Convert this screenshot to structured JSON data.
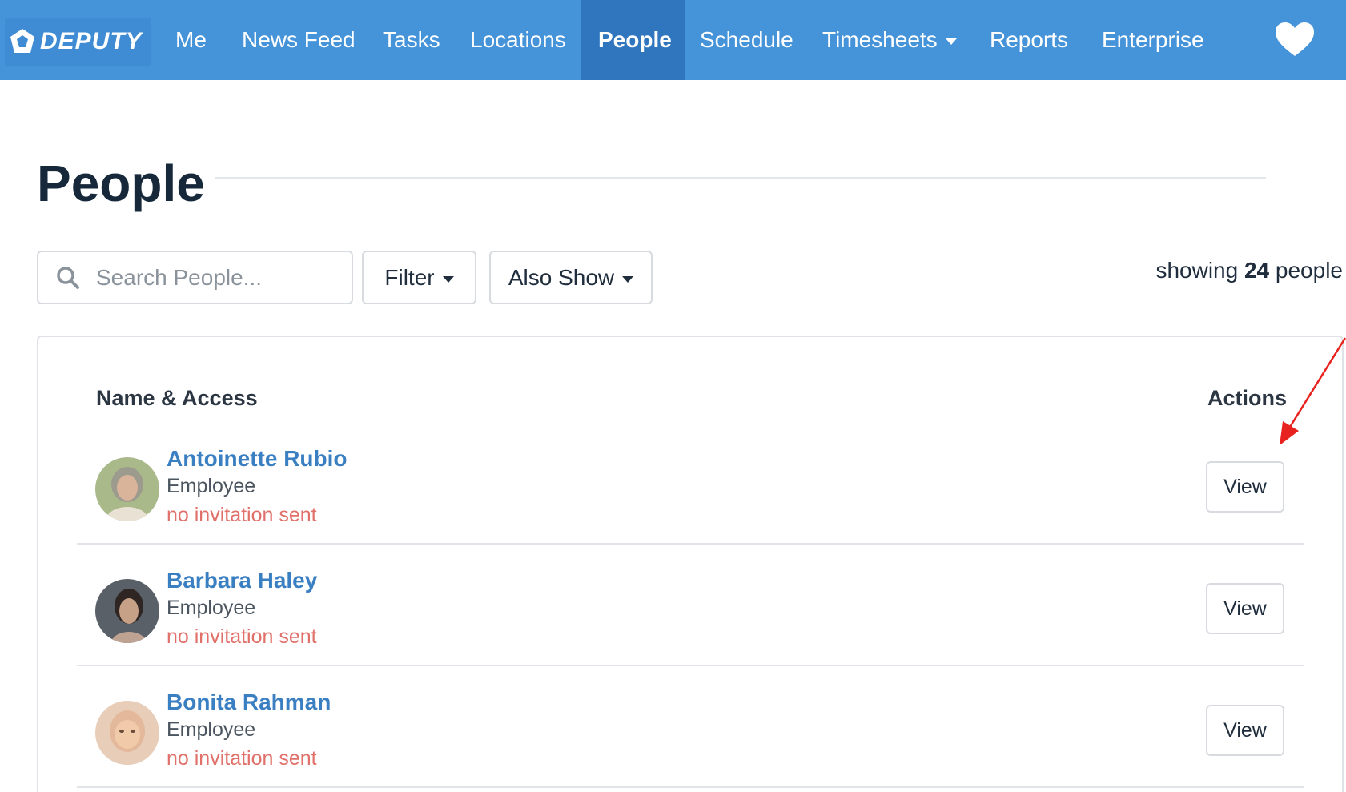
{
  "nav": {
    "brand": "DEPUTY",
    "items": [
      {
        "label": "Me"
      },
      {
        "label": "News Feed"
      },
      {
        "label": "Tasks"
      },
      {
        "label": "Locations"
      },
      {
        "label": "People",
        "active": true
      },
      {
        "label": "Schedule"
      },
      {
        "label": "Timesheets",
        "dropdown": true
      },
      {
        "label": "Reports"
      },
      {
        "label": "Enterprise"
      }
    ],
    "right_icon": "heart-icon"
  },
  "page": {
    "title": "People"
  },
  "toolbar": {
    "search_placeholder": "Search People...",
    "filter_label": "Filter",
    "also_show_label": "Also Show",
    "showing_prefix": "showing",
    "showing_count": "24",
    "showing_suffix": "people"
  },
  "table": {
    "headers": {
      "name": "Name & Access",
      "actions": "Actions"
    },
    "rows": [
      {
        "name": "Antoinette Rubio",
        "role": "Employee",
        "invite_status": "no invitation sent",
        "action": "View"
      },
      {
        "name": "Barbara Haley",
        "role": "Employee",
        "invite_status": "no invitation sent",
        "action": "View"
      },
      {
        "name": "Bonita Rahman",
        "role": "Employee",
        "invite_status": "no invitation sent",
        "action": "View"
      }
    ]
  },
  "colors": {
    "nav_bg": "#4593d9",
    "nav_active": "#2f76be",
    "link": "#3a7fc1",
    "warning_text": "#e07069",
    "annotation_arrow": "#e8231f"
  }
}
